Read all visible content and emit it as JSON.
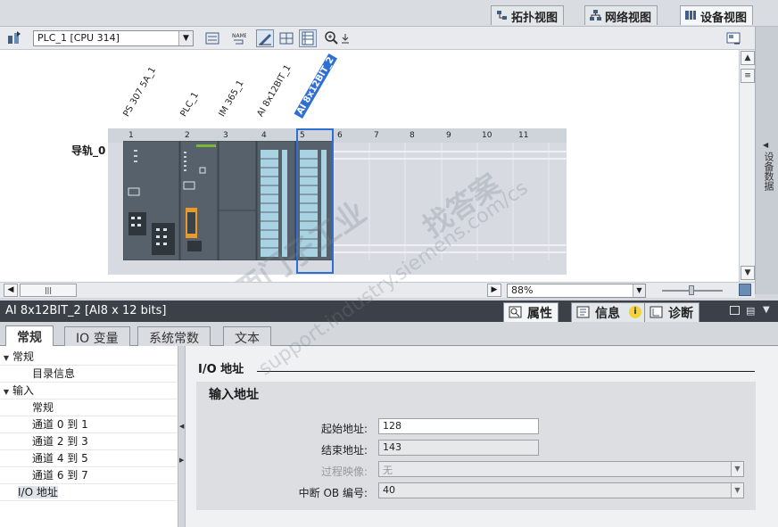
{
  "view_tabs": [
    {
      "label": "拓扑视图",
      "icon": "topology-icon",
      "active": false
    },
    {
      "label": "网络视图",
      "icon": "network-icon",
      "active": false
    },
    {
      "label": "设备视图",
      "icon": "device-icon",
      "active": true
    }
  ],
  "toolbar": {
    "device_select": "PLC_1 [CPU 314]",
    "buttons": [
      "swap-icon",
      "show-address-icon",
      "show-name-icon",
      "draw-icon",
      "grid-icon",
      "table-icon",
      "zoom-icon"
    ]
  },
  "rack": {
    "rail_label": "导轨_0",
    "slots": [
      "1",
      "2",
      "3",
      "4",
      "5",
      "6",
      "7",
      "8",
      "9",
      "10",
      "11"
    ],
    "modules": [
      {
        "slot": "1",
        "name": "PS 307 5A_1"
      },
      {
        "slot": "2",
        "name": "PLC_1"
      },
      {
        "slot": "3",
        "name": "IM 365_1"
      },
      {
        "slot": "4",
        "name": "AI 8x12BIT_1"
      },
      {
        "slot": "5",
        "name": "AI 8x12BIT_2",
        "selected": true
      }
    ]
  },
  "side_panel": {
    "label": "设备数据"
  },
  "canvas_status": {
    "zoom": "88%"
  },
  "inspector": {
    "title": "AI 8x12BIT_2 [AI8 x 12 bits]",
    "tabs": [
      {
        "label": "属性",
        "active": true
      },
      {
        "label": "信息",
        "active": false
      },
      {
        "label": "诊断",
        "active": false
      }
    ],
    "sub_tabs": [
      "常规",
      "IO 变量",
      "系统常数",
      "文本"
    ],
    "tree": [
      {
        "label": "常规",
        "level": 0,
        "expanded": true
      },
      {
        "label": "目录信息",
        "level": 1
      },
      {
        "label": "输入",
        "level": 0,
        "expanded": true
      },
      {
        "label": "常规",
        "level": 1
      },
      {
        "label": "通道 0 到 1",
        "level": 1
      },
      {
        "label": "通道 2 到 3",
        "level": 1
      },
      {
        "label": "通道 4 到 5",
        "level": 1
      },
      {
        "label": "通道 6 到 7",
        "level": 1
      },
      {
        "label": "I/O 地址",
        "level": 0,
        "selected": true
      }
    ],
    "section_title": "I/O 地址",
    "group_title": "输入地址",
    "fields": [
      {
        "label": "起始地址:",
        "value": "128",
        "state": "editable"
      },
      {
        "label": "结束地址:",
        "value": "143",
        "state": "readonly"
      },
      {
        "label": "过程映像:",
        "value": "无",
        "state": "disabled"
      },
      {
        "label": "中断 OB 编号:",
        "value": "40",
        "state": "dropdown"
      }
    ]
  },
  "watermark": {
    "line1": "西门子工业",
    "line2": "找答案",
    "line3": "support.industry.siemens.com/cs"
  }
}
